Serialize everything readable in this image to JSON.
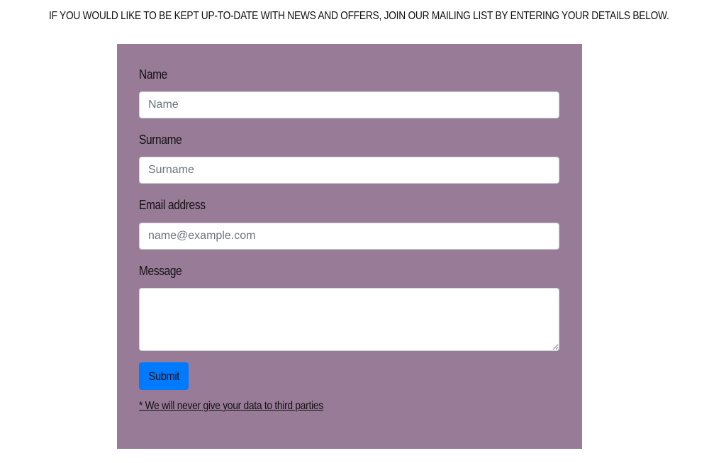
{
  "intro_text": "IF YOU WOULD LIKE TO BE KEPT UP-TO-DATE WITH NEWS AND OFFERS, JOIN OUR MAILING LIST BY ENTERING YOUR DETAILS BELOW.",
  "form": {
    "name": {
      "label": "Name",
      "placeholder": "Name",
      "value": ""
    },
    "surname": {
      "label": "Surname",
      "placeholder": "Surname",
      "value": ""
    },
    "email": {
      "label": "Email address",
      "placeholder": "name@example.com",
      "value": ""
    },
    "message": {
      "label": "Message",
      "value": ""
    },
    "submit_label": "Submit",
    "privacy_note": "* We will never give your data to third parties"
  },
  "colors": {
    "panel_background": "#987b97",
    "submit_button": "#007bff",
    "page_background": "#ffffff"
  }
}
